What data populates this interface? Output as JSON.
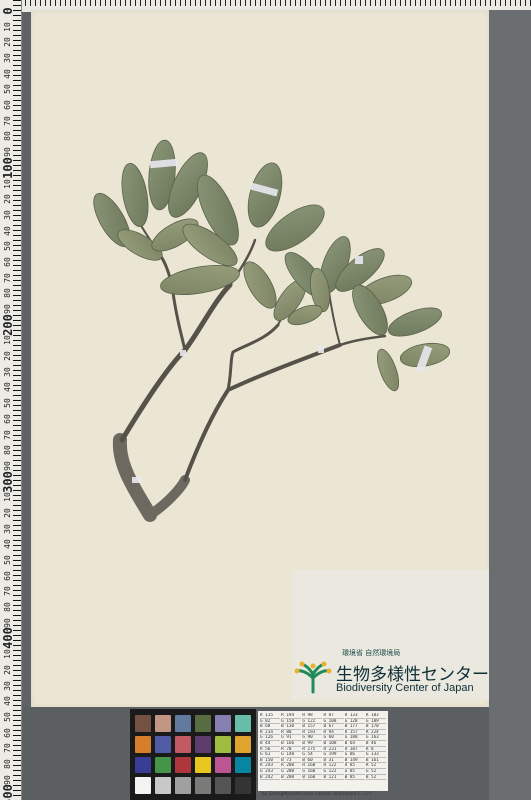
{
  "ruler": {
    "labels": [
      "0",
      "10",
      "20",
      "30",
      "40",
      "50",
      "60",
      "70",
      "80",
      "90",
      "100",
      "10",
      "20",
      "30",
      "40",
      "50",
      "60",
      "70",
      "80",
      "90",
      "200",
      "10",
      "20",
      "30",
      "40",
      "50",
      "60",
      "70",
      "80",
      "90",
      "300",
      "10",
      "20",
      "30",
      "40",
      "50",
      "60",
      "70",
      "80",
      "90",
      "400",
      "10",
      "20",
      "30",
      "40",
      "50",
      "60",
      "70",
      "80",
      "90",
      "500"
    ]
  },
  "institution": {
    "ministry": "環境省 自然環境局",
    "name_jp": "生物多様性センター",
    "name_en": "Biodiversity Center of Japan"
  },
  "color_checker": {
    "swatches": [
      "#735244",
      "#c29682",
      "#627a9d",
      "#576c43",
      "#8580b1",
      "#67bdaa",
      "#d67e2c",
      "#505ba6",
      "#c15a63",
      "#5e3c6c",
      "#9dbc40",
      "#e0a32e",
      "#383d96",
      "#469449",
      "#af363c",
      "#e7c71f",
      "#bb5695",
      "#0885a1",
      "#f3f3f2",
      "#c8c8c8",
      "#a0a0a0",
      "#7a7a79",
      "#555555",
      "#343434"
    ]
  },
  "color_values": {
    "cells": [
      "R 115",
      "R 194",
      "R 98",
      "R 87",
      "R 133",
      "R 103",
      "G 82",
      "G 150",
      "G 122",
      "G 108",
      "G 128",
      "G 189",
      "B 68",
      "B 130",
      "B 157",
      "B 67",
      "B 177",
      "B 170",
      "R 214",
      "R 80",
      "R 193",
      "R 94",
      "R 157",
      "R 224",
      "G 126",
      "G 91",
      "G 90",
      "G 60",
      "G 188",
      "G 163",
      "B 44",
      "B 166",
      "B 99",
      "B 108",
      "B 64",
      "B 46",
      "R 56",
      "R 70",
      "R 175",
      "R 231",
      "R 187",
      "R 8",
      "G 61",
      "G 148",
      "G 54",
      "G 199",
      "G 86",
      "G 133",
      "B 150",
      "B 73",
      "B 60",
      "B 31",
      "B 149",
      "B 161",
      "R 243",
      "R 200",
      "R 160",
      "R 122",
      "R 85",
      "R 52",
      "G 243",
      "G 200",
      "G 160",
      "G 122",
      "G 85",
      "G 52",
      "B 242",
      "B 200",
      "B 160",
      "B 121",
      "B 85",
      "B 52"
    ],
    "credit": "by GretagMacbeth color checker (Illuminant C / 2°)"
  },
  "colors": {
    "paper": "#ebe6d4",
    "leaf": "#7f8a6a",
    "stem": "#5b5650"
  }
}
